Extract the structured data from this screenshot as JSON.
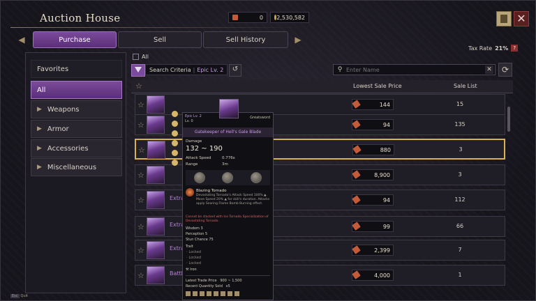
{
  "window": {
    "title": "Auction House"
  },
  "currency": {
    "first_value": "0",
    "second_value": "2,530,582"
  },
  "tabs": [
    {
      "label": "Purchase",
      "active": true
    },
    {
      "label": "Sell",
      "active": false
    },
    {
      "label": "Sell History",
      "active": false
    }
  ],
  "tax": {
    "label": "Tax Rate",
    "value": "21%",
    "help": "?"
  },
  "sidebar": {
    "items": [
      {
        "label": "Favorites"
      },
      {
        "label": "All"
      },
      {
        "label": "Weapons"
      },
      {
        "label": "Armor"
      },
      {
        "label": "Accessories"
      },
      {
        "label": "Miscellaneous"
      }
    ]
  },
  "filters": {
    "all_label": "All",
    "criteria_label": "Search Criteria",
    "criteria_value": "Epic Lv. 2",
    "search_placeholder": "Enter Name"
  },
  "table": {
    "headers": {
      "price": "Lowest Sale Price",
      "list": "Sale List"
    },
    "rows": [
      {
        "name": "",
        "price": "144",
        "count": "15"
      },
      {
        "name": "",
        "price": "94",
        "count": "135"
      },
      {
        "name": "",
        "price": "880",
        "count": "3"
      },
      {
        "name": "",
        "price": "8,900",
        "count": "3"
      },
      {
        "name": "Extra",
        "price": "94",
        "count": "112"
      },
      {
        "name": "Extra",
        "price": "99",
        "count": "66"
      },
      {
        "name": "Extra",
        "price": "2,399",
        "count": "7"
      },
      {
        "name": "Battle",
        "price": "4,000",
        "count": "1"
      }
    ]
  },
  "tooltip": {
    "level": "Epic Lv. 2",
    "enhance": "Lv. 0",
    "kind": "Greatsword",
    "name": "Gatekeeper of Hell's Gale Blade",
    "damage_label": "Damage",
    "damage": "132 ~ 190",
    "attack_speed_label": "Attack Speed",
    "attack_speed": "0.776s",
    "range_label": "Range",
    "range": "3m",
    "skill_title": "Blazing Tornado",
    "skill_desc": "Devastating Tornado's Attack Speed 100% ▲. Move Speed 20% ▲ for skill's duration. Attacks apply Searing Flame Bomb Burning effect.",
    "warning": "Cannot be stacked with Ice Tornado Specialization of Devastating Tornado.",
    "stats": [
      "Wisdom  3",
      "Perception  5",
      "Stun Chance  75"
    ],
    "trait_label": "Trait",
    "traits": [
      "Locked",
      "Locked",
      "Locked"
    ],
    "material": "Iron",
    "trade_label": "Latest Trade Price",
    "trade_value": "900 ~ 1,500",
    "sold_label": "Recent Quantity Sold",
    "sold_value": "x5"
  },
  "footer": {
    "key": "Esc",
    "label": "Quit"
  },
  "colors": {
    "accent": "#7b4b9b",
    "highlight": "#d9b252",
    "epic": "#c89de6"
  }
}
